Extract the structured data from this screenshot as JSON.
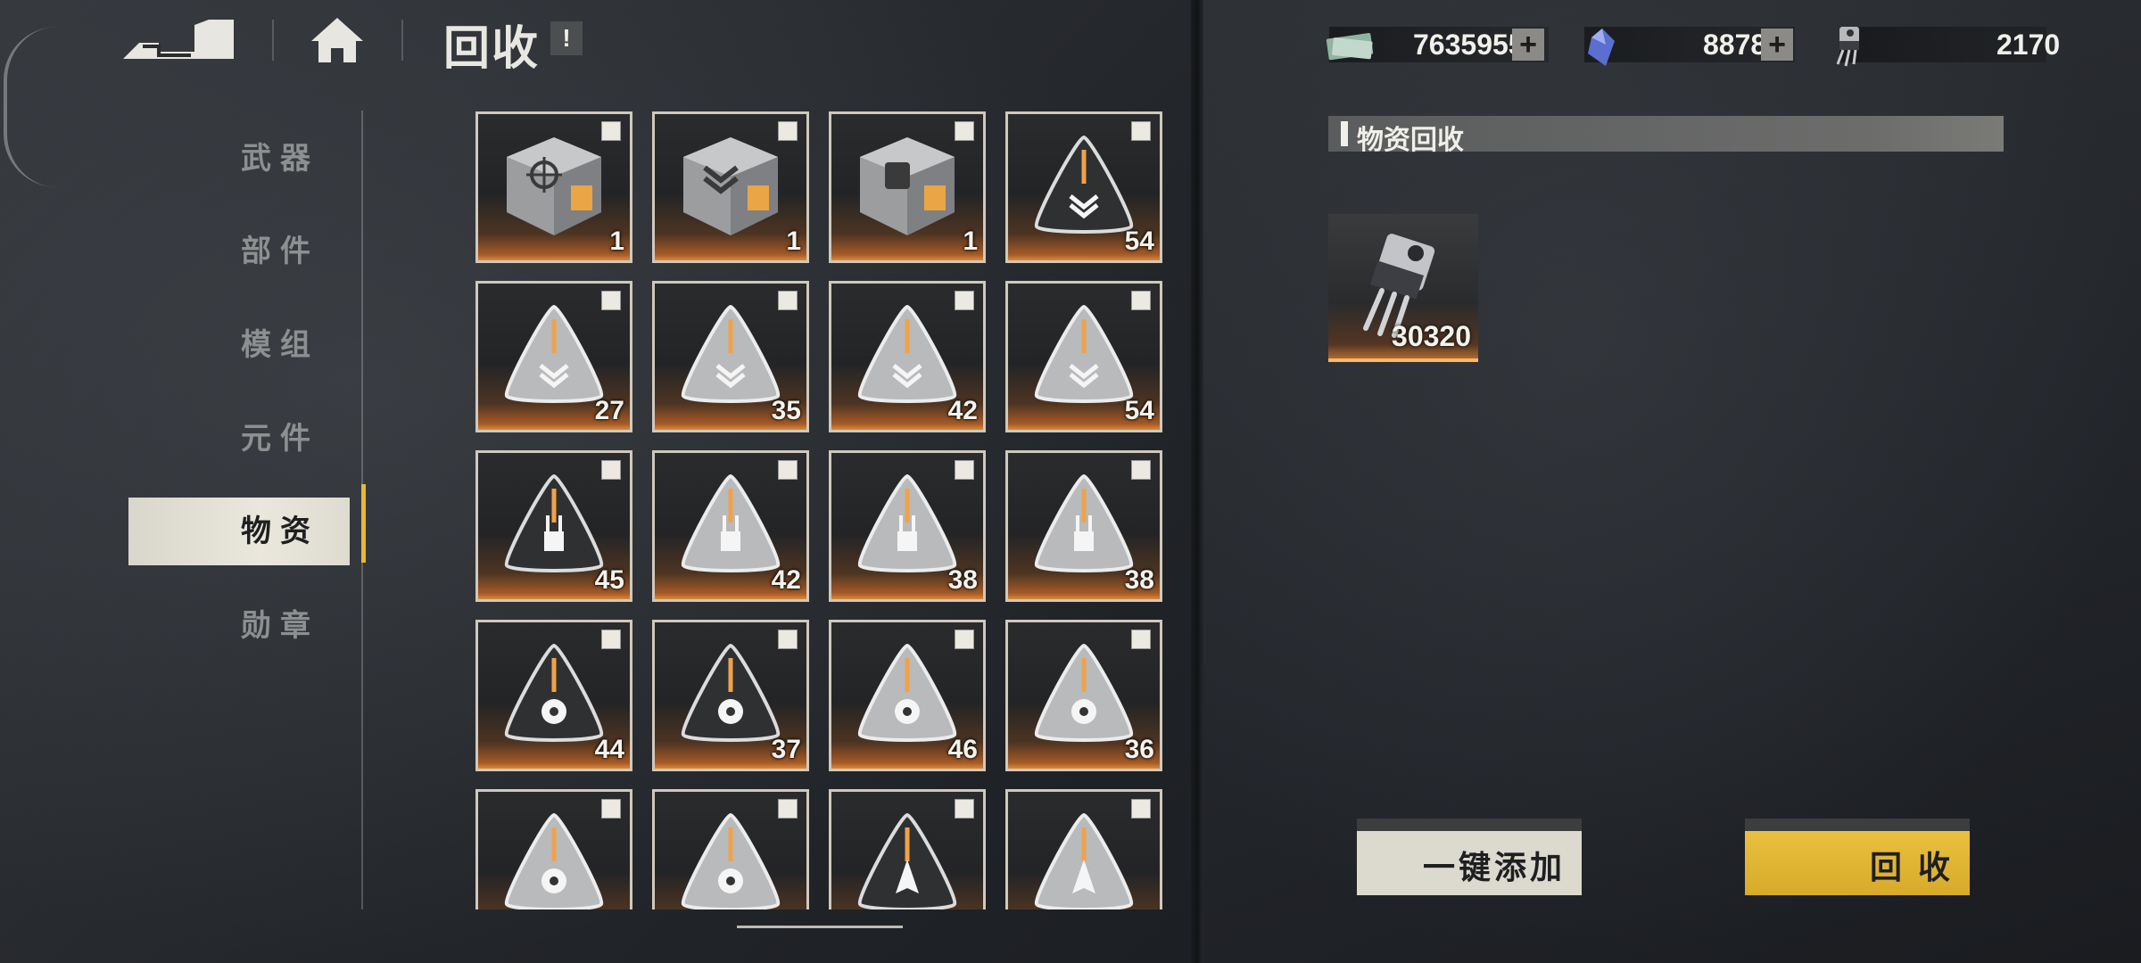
{
  "header": {
    "title": "回收",
    "info_label": "!"
  },
  "sidebar": {
    "items": [
      {
        "label": "武器",
        "active": false
      },
      {
        "label": "部件",
        "active": false
      },
      {
        "label": "模组",
        "active": false
      },
      {
        "label": "元件",
        "active": false
      },
      {
        "label": "物资",
        "active": true
      },
      {
        "label": "勋章",
        "active": false
      }
    ]
  },
  "grid": {
    "items": [
      {
        "icon": "crate-target-icon",
        "count": "1"
      },
      {
        "icon": "crate-chevron-icon",
        "count": "1"
      },
      {
        "icon": "crate-fist-icon",
        "count": "1"
      },
      {
        "icon": "pyramid-dark-chevron-icon",
        "count": "54"
      },
      {
        "icon": "pyramid-silver-chevron-icon",
        "count": "27"
      },
      {
        "icon": "pyramid-silver-chevron-icon",
        "count": "35"
      },
      {
        "icon": "pyramid-silver-chevron-icon",
        "count": "42"
      },
      {
        "icon": "pyramid-silver-chevron-icon",
        "count": "54"
      },
      {
        "icon": "pyramid-dark-turret-icon",
        "count": "45"
      },
      {
        "icon": "pyramid-silver-turret-icon",
        "count": "42"
      },
      {
        "icon": "pyramid-silver-turret-icon",
        "count": "38"
      },
      {
        "icon": "pyramid-silver-turret-icon",
        "count": "38"
      },
      {
        "icon": "pyramid-dark-fan-icon",
        "count": "44"
      },
      {
        "icon": "pyramid-dark-fan-icon",
        "count": "37"
      },
      {
        "icon": "pyramid-silver-fan-icon",
        "count": "46"
      },
      {
        "icon": "pyramid-silver-fan-icon",
        "count": "36"
      },
      {
        "icon": "pyramid-silver-fan-icon",
        "count": ""
      },
      {
        "icon": "pyramid-silver-fan-icon",
        "count": ""
      },
      {
        "icon": "pyramid-dark-blade-icon",
        "count": ""
      },
      {
        "icon": "pyramid-silver-blade-icon",
        "count": ""
      }
    ]
  },
  "currency": {
    "cash": {
      "value": "7635955",
      "icon": "banknote-icon"
    },
    "crystal": {
      "value": "8878",
      "icon": "crystal-icon"
    },
    "component": {
      "value": "2170",
      "icon": "transistor-icon"
    },
    "plus_label": "+"
  },
  "recycle_panel": {
    "title": "物资回收",
    "result": {
      "icon": "transistor-icon",
      "count": "30320"
    }
  },
  "actions": {
    "add_all_label": "一键添加",
    "recycle_label": "回 收"
  },
  "colors": {
    "accent_yellow": "#e7b73a",
    "card_glow": "#d98a3b",
    "active_tab_bg": "#eae7dd"
  }
}
